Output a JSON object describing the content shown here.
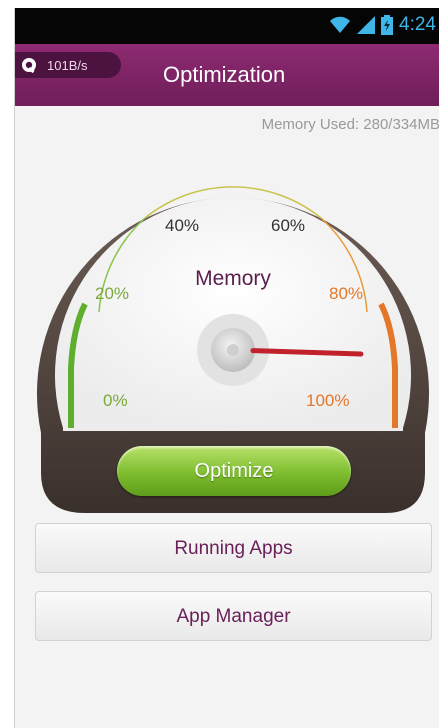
{
  "statusbar": {
    "time": "4:24"
  },
  "titlebar": {
    "speed": "101B/s",
    "title": "Optimization"
  },
  "memory": {
    "used_label": "Memory Used: 280/334MB",
    "gauge_title": "Memory",
    "level_percent": 84,
    "ticks": [
      "0%",
      "20%",
      "40%",
      "60%",
      "80%",
      "100%"
    ]
  },
  "buttons": {
    "optimize": "Optimize",
    "running_apps": "Running Apps",
    "app_manager": "App Manager"
  },
  "colors": {
    "title_bar": "#7a2263",
    "green": "#7dbd2e",
    "orange": "#e3782a",
    "needle": "#c0212b"
  },
  "icons": [
    "wifi-icon",
    "signal-icon",
    "battery-icon",
    "q-logo-icon"
  ]
}
